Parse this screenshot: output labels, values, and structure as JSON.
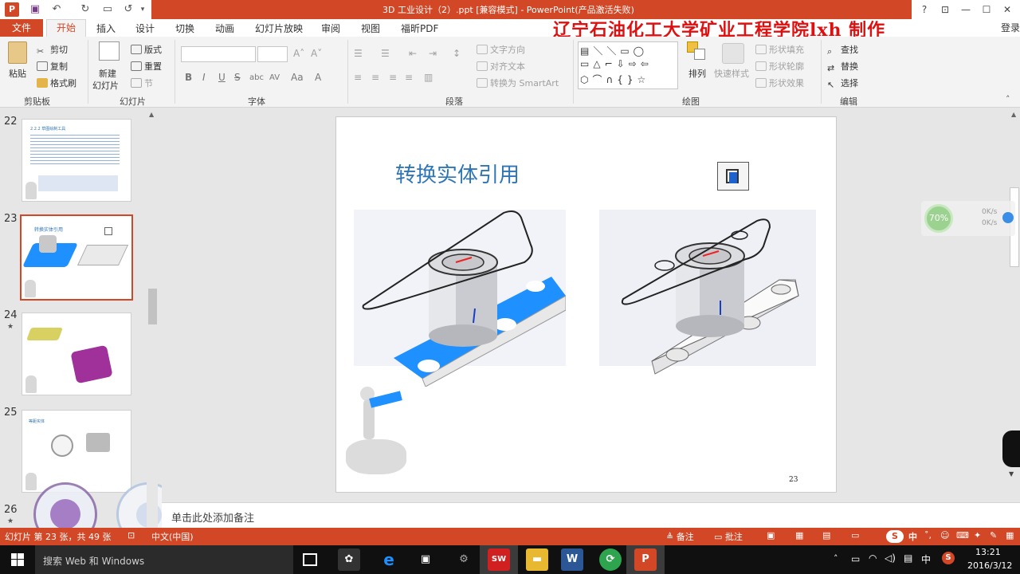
{
  "titlebar": {
    "title": "3D 工业设计（2）.ppt [兼容模式] -  PowerPoint(产品激活失败)",
    "controls": [
      "?",
      "⊡",
      "—",
      "☐",
      "✕"
    ]
  },
  "tabs": {
    "file": "文件",
    "items": [
      "开始",
      "插入",
      "设计",
      "切换",
      "动画",
      "幻灯片放映",
      "审阅",
      "视图",
      "福昕PDF"
    ],
    "login": "登录"
  },
  "brand_text": "辽宁石油化工大学矿业工程学院lxh 制作",
  "ribbon": {
    "clipboard": {
      "paste": "粘贴",
      "cut": "剪切",
      "copy": "复制",
      "format_painter": "格式刷",
      "label": "剪贴板"
    },
    "slides": {
      "new_slide_line1": "新建",
      "new_slide_line2": "幻灯片",
      "layout": "版式",
      "reset": "重置",
      "section": "节",
      "label": "幻灯片"
    },
    "font": {
      "label": "字体",
      "formats": [
        "B",
        "I",
        "U",
        "S",
        "abc",
        "AV",
        "Aa",
        "A"
      ]
    },
    "paragraph": {
      "text_direction": "文字方向",
      "align_text": "对齐文本",
      "smartart": "转换为 SmartArt",
      "label": "段落"
    },
    "drawing": {
      "arrange": "排列",
      "quick_styles": "快速样式",
      "shape_fill": "形状填充",
      "shape_outline": "形状轮廓",
      "shape_effects": "形状效果",
      "label": "绘图"
    },
    "editing": {
      "find": "查找",
      "replace": "替换",
      "select": "选择",
      "label": "编辑"
    }
  },
  "slides_panel": [
    {
      "number": "22",
      "star": false,
      "thumb_title": "2.2.2 草图绘制工具"
    },
    {
      "number": "23",
      "star": false,
      "thumb_title": "转换实体引用",
      "selected": true
    },
    {
      "number": "24",
      "star": true,
      "thumb_title": ""
    },
    {
      "number": "25",
      "star": false,
      "thumb_title": "等距实体"
    },
    {
      "number": "26",
      "star": true,
      "thumb_title": ""
    }
  ],
  "slide": {
    "title": "转换实体引用",
    "page_number": "23"
  },
  "notes_placeholder": "单击此处添加备注",
  "statusbar": {
    "slide_info": "幻灯片 第 23 张，共 49 张",
    "language": "中文(中国)",
    "notes_btn": "备注",
    "comments_btn": "批注"
  },
  "netwidget": {
    "percent": "70%",
    "up": "0K/s",
    "down": "0K/s"
  },
  "taskbar": {
    "search_placeholder": "搜索 Web 和 Windows",
    "time": "13:21",
    "date": "2016/3/12",
    "ime": "中"
  },
  "colors": {
    "accent": "#d24726",
    "title_blue": "#2e75b6",
    "brand_red": "#e01010",
    "highlight_blue": "#1e90ff"
  }
}
